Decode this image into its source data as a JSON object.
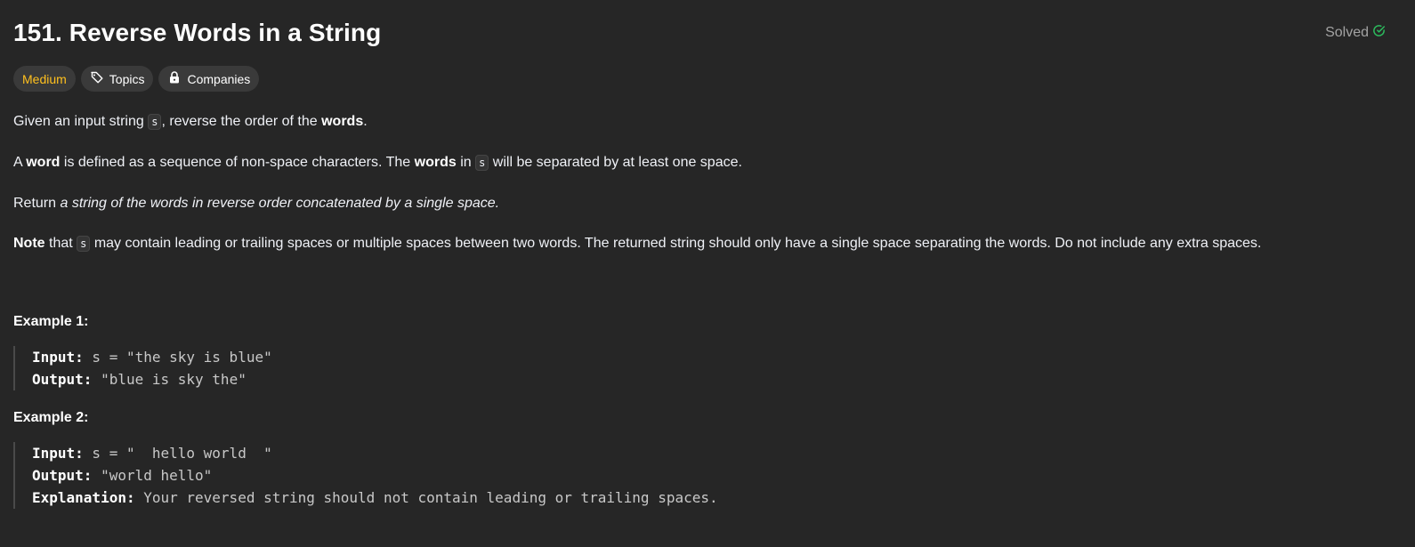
{
  "problem": {
    "title": "151. Reverse Words in a String",
    "status": "Solved",
    "tags": {
      "difficulty": "Medium",
      "topics": "Topics",
      "companies": "Companies"
    }
  },
  "description": {
    "p1": {
      "a": "Given an input string ",
      "code": "s",
      "b": ", reverse the order of the ",
      "bold": "words",
      "c": "."
    },
    "p2": {
      "a": "A ",
      "bold1": "word",
      "b": " is defined as a sequence of non-space characters. The ",
      "bold2": "words",
      "c": " in ",
      "code": "s",
      "d": " will be separated by at least one space."
    },
    "p3": {
      "a": "Return ",
      "italic": "a string of the words in reverse order concatenated by a single space."
    },
    "p4": {
      "bold": "Note",
      "a": " that ",
      "code": "s",
      "b": " may contain leading or trailing spaces or multiple spaces between two words. The returned string should only have a single space separating the words. Do not include any extra spaces."
    }
  },
  "examples": [
    {
      "title": "Example 1:",
      "input_label": "Input:",
      "input_value": " s = \"the sky is blue\"",
      "output_label": "Output:",
      "output_value": " \"blue is sky the\""
    },
    {
      "title": "Example 2:",
      "input_label": "Input:",
      "input_value": " s = \"  hello world  \"",
      "output_label": "Output:",
      "output_value": " \"world hello\"",
      "explanation_label": "Explanation:",
      "explanation_value": " Your reversed string should not contain leading or trailing spaces."
    }
  ],
  "colors": {
    "background": "#262626",
    "difficulty_medium": "#ffc01e",
    "solved_check": "#2cbb5d"
  },
  "icons": {
    "solved": "check-circle-icon",
    "topics": "tag-icon",
    "companies": "lock-icon"
  }
}
